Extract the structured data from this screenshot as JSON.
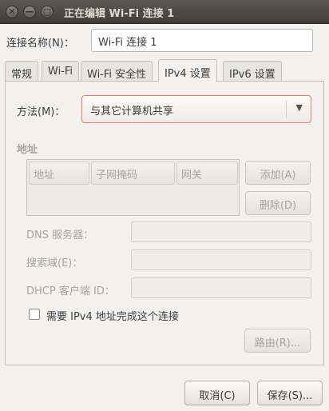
{
  "window": {
    "title": "正在编辑 Wi-Fi 连接 1",
    "close_glyph": "✕",
    "minimize_glyph": "—",
    "maximize_glyph": "□"
  },
  "connection": {
    "name_label": "连接名称(N)：",
    "name_value": "Wi-Fi 连接 1"
  },
  "tabs": [
    {
      "label": "常规"
    },
    {
      "label": "Wi-Fi"
    },
    {
      "label": "Wi-Fi 安全性"
    },
    {
      "label": "IPv4 设置",
      "active": true
    },
    {
      "label": "IPv6 设置"
    }
  ],
  "ipv4": {
    "method_label": "方法(M)：",
    "method_value": "与其它计算机共享",
    "dropdown_arrow": "▼",
    "address_heading": "地址",
    "columns": [
      "地址",
      "子网掩码",
      "网关"
    ],
    "add_button": "添加(A)",
    "delete_button": "删除(D)",
    "dns_label": "DNS 服务器：",
    "search_domains_label": "搜索域(E)：",
    "dhcp_client_id_label": "DHCP 客户端 ID：",
    "require_ipv4_label": "需要 IPv4 地址完成这个连接",
    "require_ipv4_checked": false,
    "routes_button": "路由(R)..."
  },
  "footer": {
    "cancel_button": "取消(C)",
    "save_button": "保存(S)..."
  }
}
